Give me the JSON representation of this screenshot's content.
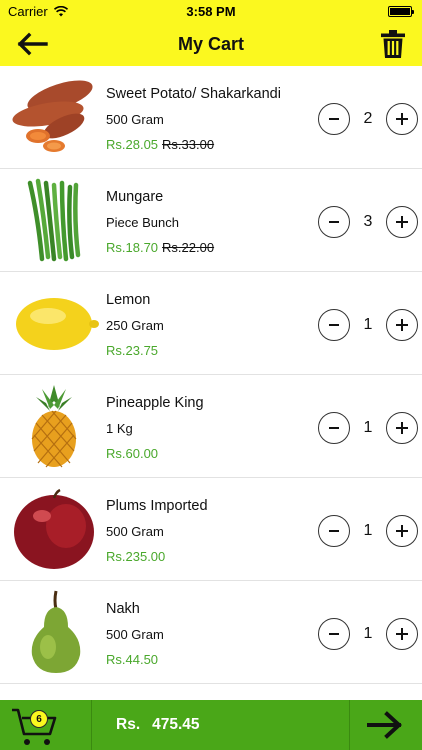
{
  "status_bar": {
    "carrier": "Carrier",
    "time": "3:58 PM"
  },
  "nav": {
    "title": "My Cart"
  },
  "items": [
    {
      "name": "Sweet Potato/ Shakarkandi",
      "unit": "500 Gram",
      "price": "Rs.28.05",
      "original_price": "Rs.33.00",
      "qty": "2",
      "image": "sweet-potato"
    },
    {
      "name": "Mungare",
      "unit": "Piece Bunch",
      "price": "Rs.18.70",
      "original_price": "Rs.22.00",
      "qty": "3",
      "image": "green-beans"
    },
    {
      "name": "Lemon",
      "unit": "250 Gram",
      "price": "Rs.23.75",
      "original_price": "",
      "qty": "1",
      "image": "lemon"
    },
    {
      "name": "Pineapple King",
      "unit": "1 Kg",
      "price": "Rs.60.00",
      "original_price": "",
      "qty": "1",
      "image": "pineapple"
    },
    {
      "name": "Plums Imported",
      "unit": "500 Gram",
      "price": "Rs.235.00",
      "original_price": "",
      "qty": "1",
      "image": "plum"
    },
    {
      "name": "Nakh",
      "unit": "500 Gram",
      "price": "Rs.44.50",
      "original_price": "",
      "qty": "1",
      "image": "pear"
    }
  ],
  "bottom_bar": {
    "cart_count": "6",
    "total_label": "Rs.",
    "total_value": "475.45"
  },
  "colors": {
    "header": "#fbf81f",
    "price_green": "#4aa82c",
    "bottom_bar": "#4aa718"
  },
  "icons": {
    "back": "arrow-left-icon",
    "trash": "trash-icon",
    "decrement": "minus-icon",
    "increment": "plus-icon",
    "cart": "shopping-cart-icon",
    "next": "arrow-right-icon",
    "wifi": "wifi-icon",
    "battery": "battery-icon"
  }
}
